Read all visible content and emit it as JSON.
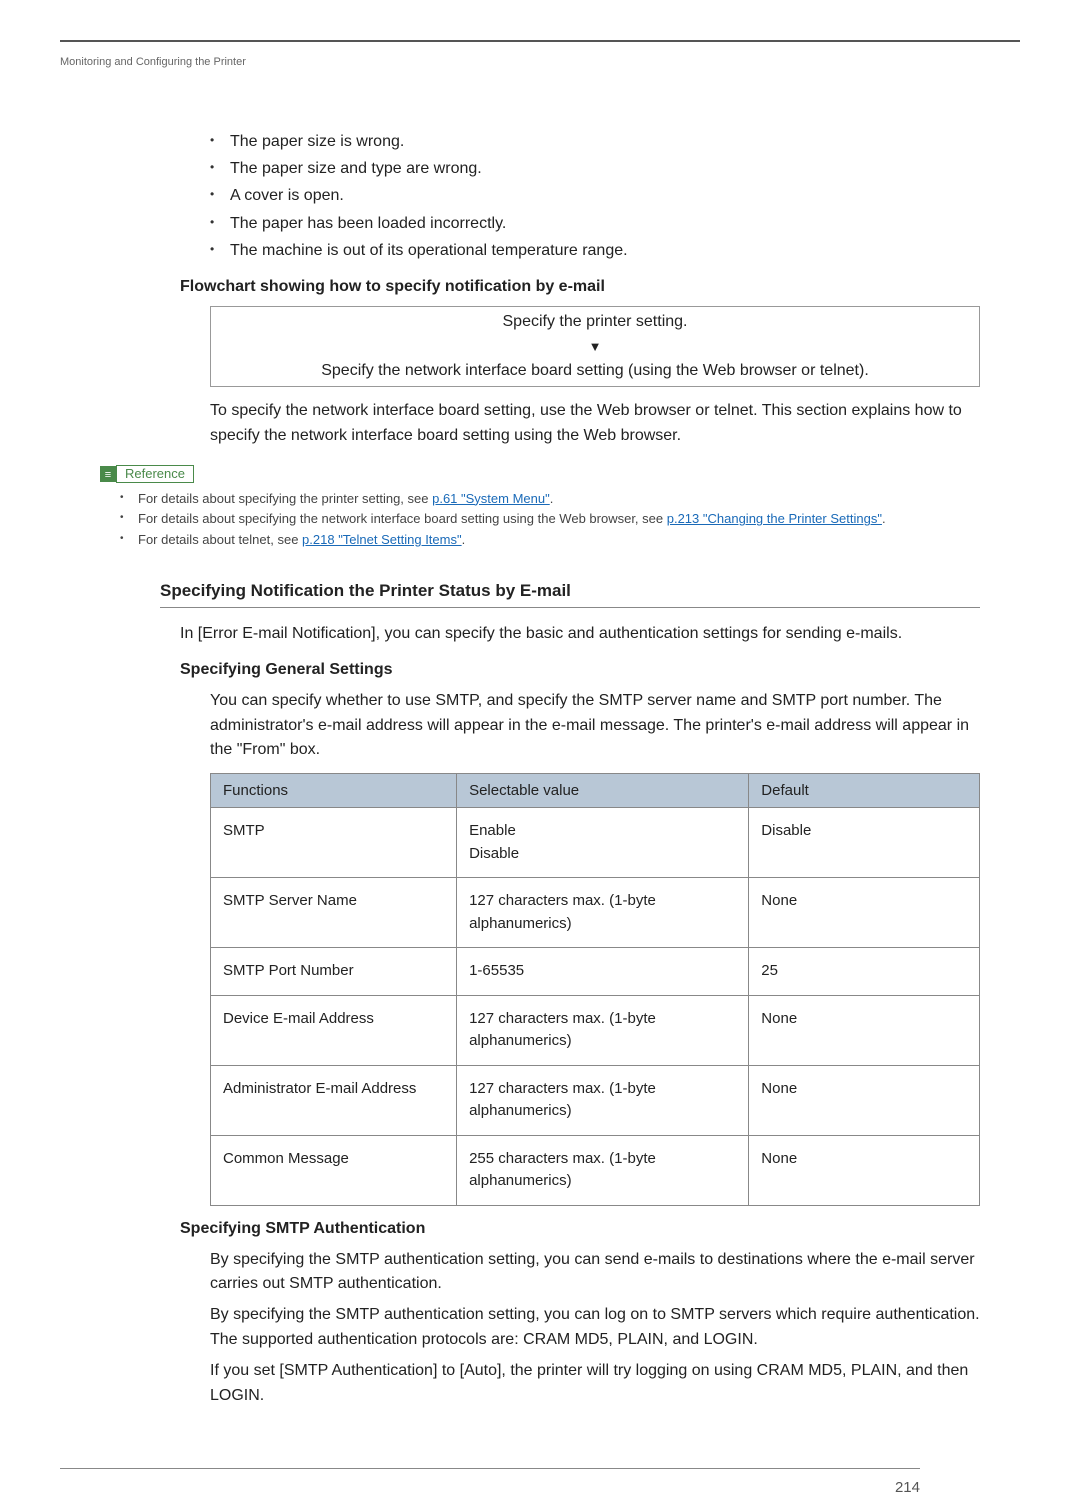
{
  "header": {
    "breadcrumb": "Monitoring and Configuring the Printer"
  },
  "bullets": {
    "b0": "The paper size is wrong.",
    "b1": "The paper size and type are wrong.",
    "b2": "A cover is open.",
    "b3": "The paper has been loaded incorrectly.",
    "b4": "The machine is out of its operational temperature range."
  },
  "flowchart": {
    "heading": "Flowchart showing how to specify notification by e-mail",
    "row1": "Specify the printer setting.",
    "row2": "Specify the network interface board setting (using the Web browser or telnet).",
    "note": "To specify the network interface board setting, use the Web browser or telnet. This section explains how to specify the network interface board setting using the Web browser."
  },
  "reference": {
    "label": "Reference",
    "r0a": "For details about specifying the printer setting, see ",
    "r0link": "p.61 \"System Menu\"",
    "r0b": ".",
    "r1a": "For details about specifying the network interface board setting using the Web browser, see ",
    "r1link": "p.213 \"Changing the Printer Settings\"",
    "r1b": ".",
    "r2a": "For details about telnet, see ",
    "r2link": "p.218 \"Telnet Setting Items\"",
    "r2b": "."
  },
  "section": {
    "heading": "Specifying Notification the Printer Status by E-mail",
    "intro": "In [Error E-mail Notification], you can specify the basic and authentication settings for sending e-mails."
  },
  "general": {
    "heading": "Specifying General Settings",
    "para": "You can specify whether to use SMTP, and specify the SMTP server name and SMTP port number. The administrator's e-mail address will appear in the e-mail message. The printer's e-mail address will appear in the \"From\" box.",
    "table": {
      "h0": "Functions",
      "h1": "Selectable value",
      "h2": "Default",
      "rows": [
        {
          "f": "SMTP",
          "v": "Enable\nDisable",
          "d": "Disable"
        },
        {
          "f": "SMTP Server Name",
          "v": "127 characters max. (1-byte alphanumerics)",
          "d": "None"
        },
        {
          "f": "SMTP Port Number",
          "v": "1-65535",
          "d": "25"
        },
        {
          "f": "Device E-mail Address",
          "v": "127 characters max. (1-byte alphanumerics)",
          "d": "None"
        },
        {
          "f": "Administrator E-mail Address",
          "v": "127 characters max. (1-byte alphanumerics)",
          "d": "None"
        },
        {
          "f": "Common Message",
          "v": "255 characters max. (1-byte alphanumerics)",
          "d": "None"
        }
      ]
    }
  },
  "smtpauth": {
    "heading": "Specifying SMTP Authentication",
    "p0": "By specifying the SMTP authentication setting, you can send e-mails to destinations where the e-mail server carries out SMTP authentication.",
    "p1": "By specifying the SMTP authentication setting, you can log on to SMTP servers which require authentication. The supported authentication protocols are: CRAM MD5, PLAIN, and LOGIN.",
    "p2": "If you set [SMTP Authentication] to [Auto], the printer will try logging on using CRAM MD5, PLAIN, and then LOGIN."
  },
  "footer": {
    "page": "214"
  }
}
